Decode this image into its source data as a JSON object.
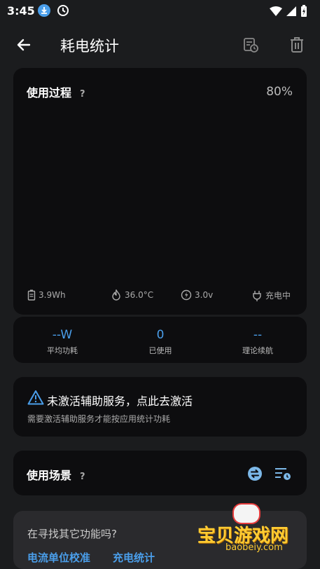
{
  "status": {
    "time": "3:45"
  },
  "appbar": {
    "title": "耗电统计"
  },
  "usage": {
    "title": "使用过程",
    "help": "?",
    "percent": "80%",
    "stats": {
      "energy": "3.9Wh",
      "temp": "36.0°C",
      "voltage": "3.0v",
      "state": "充电中"
    }
  },
  "metrics": [
    {
      "value": "--W",
      "label": "平均功耗"
    },
    {
      "value": "0",
      "label": "已使用"
    },
    {
      "value": "--",
      "label": "理论续航"
    }
  ],
  "warning": {
    "title": "未激活辅助服务，点此去激活",
    "subtitle": "需要激活辅助服务才能按应用统计功耗"
  },
  "scene": {
    "title": "使用场景",
    "help": "?"
  },
  "more": {
    "question": "在寻找其它功能吗?",
    "link1": "电流单位校准",
    "link2": "充电统计"
  },
  "watermark": {
    "text": "宝贝游戏网",
    "url": "baobeiy.com"
  },
  "colors": {
    "accent": "#4a9eea",
    "background": "#1b1c1e",
    "card": "#0d0d0f",
    "watermark": "#ffcc33"
  }
}
